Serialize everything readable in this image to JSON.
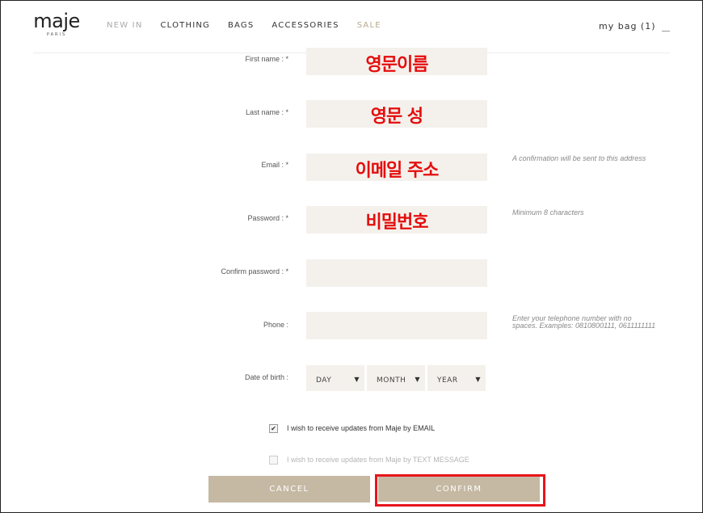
{
  "header": {
    "logo": "maje",
    "logo_sub": "PARIS",
    "nav": [
      "NEW IN",
      "CLOTHING",
      "BAGS",
      "ACCESSORIES",
      "SALE"
    ],
    "bag": "my bag (1)"
  },
  "form": {
    "first_name": {
      "label": "First name : *",
      "overlay": "영문이름"
    },
    "last_name": {
      "label": "Last name : *",
      "overlay": "영문 성"
    },
    "email": {
      "label": "Email : *",
      "overlay": "이메일 주소",
      "hint": "A confirmation will be sent to this address"
    },
    "password": {
      "label": "Password : *",
      "overlay": "비밀번호",
      "hint": "Minimum 8 characters"
    },
    "confirm_password": {
      "label": "Confirm password : *"
    },
    "phone": {
      "label": "Phone :",
      "hint": "Enter your telephone number with no spaces. Examples: 0810800111, 0611111111"
    },
    "dob": {
      "label": "Date of birth :",
      "day": "DAY",
      "month": "MONTH",
      "year": "YEAR"
    },
    "optin_email": {
      "label": "I wish to receive updates from Maje by EMAIL",
      "checked": true
    },
    "optin_sms": {
      "label": "I wish to receive updates from Maje by TEXT MESSAGE",
      "checked": false
    }
  },
  "buttons": {
    "cancel": "CANCEL",
    "confirm": "CONFIRM"
  },
  "colors": {
    "field_bg": "#f4f1ec",
    "button_bg": "#c5b9a3",
    "overlay_text": "#e50d0d",
    "highlight": "#e8141c",
    "sale": "#b9aa8e"
  }
}
